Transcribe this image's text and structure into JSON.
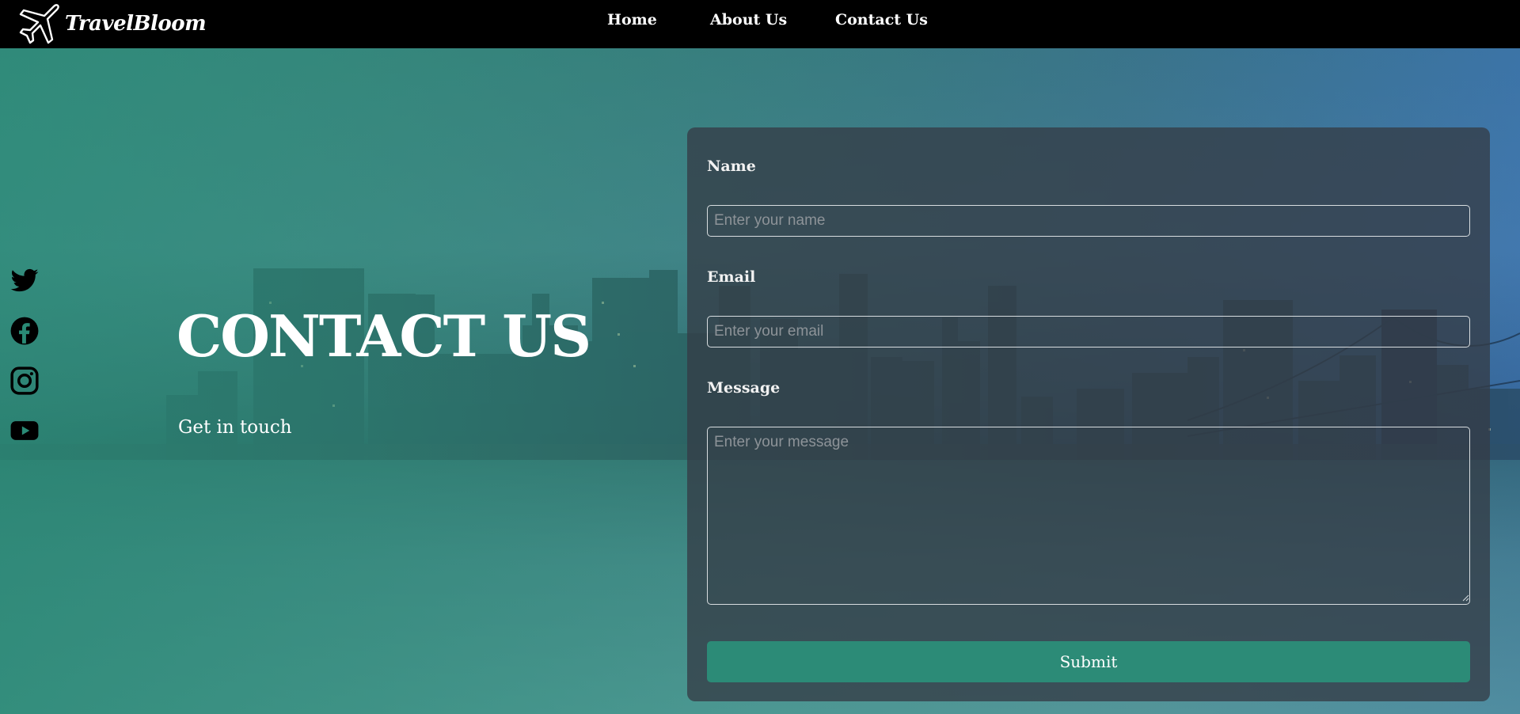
{
  "brand": {
    "name": "TravelBloom",
    "icon": "airplane-icon"
  },
  "nav": {
    "links": [
      {
        "label": "Home"
      },
      {
        "label": "About Us"
      },
      {
        "label": "Contact Us"
      }
    ]
  },
  "hero": {
    "title": "CONTACT US",
    "subtitle": "Get in touch",
    "background": "city-skyline-waterfront-photo"
  },
  "socials": [
    {
      "icon": "twitter-icon"
    },
    {
      "icon": "facebook-icon"
    },
    {
      "icon": "instagram-icon"
    },
    {
      "icon": "youtube-icon"
    }
  ],
  "form": {
    "name_label": "Name",
    "name_placeholder": "Enter your name",
    "name_value": "",
    "email_label": "Email",
    "email_placeholder": "Enter your email",
    "email_value": "",
    "message_label": "Message",
    "message_placeholder": "Enter your message",
    "message_value": "",
    "submit_label": "Submit"
  },
  "colors": {
    "nav_bg": "#000000",
    "accent": "#2c8b77",
    "card_bg": "#343c46",
    "hero_tint": "#2a8a75"
  }
}
